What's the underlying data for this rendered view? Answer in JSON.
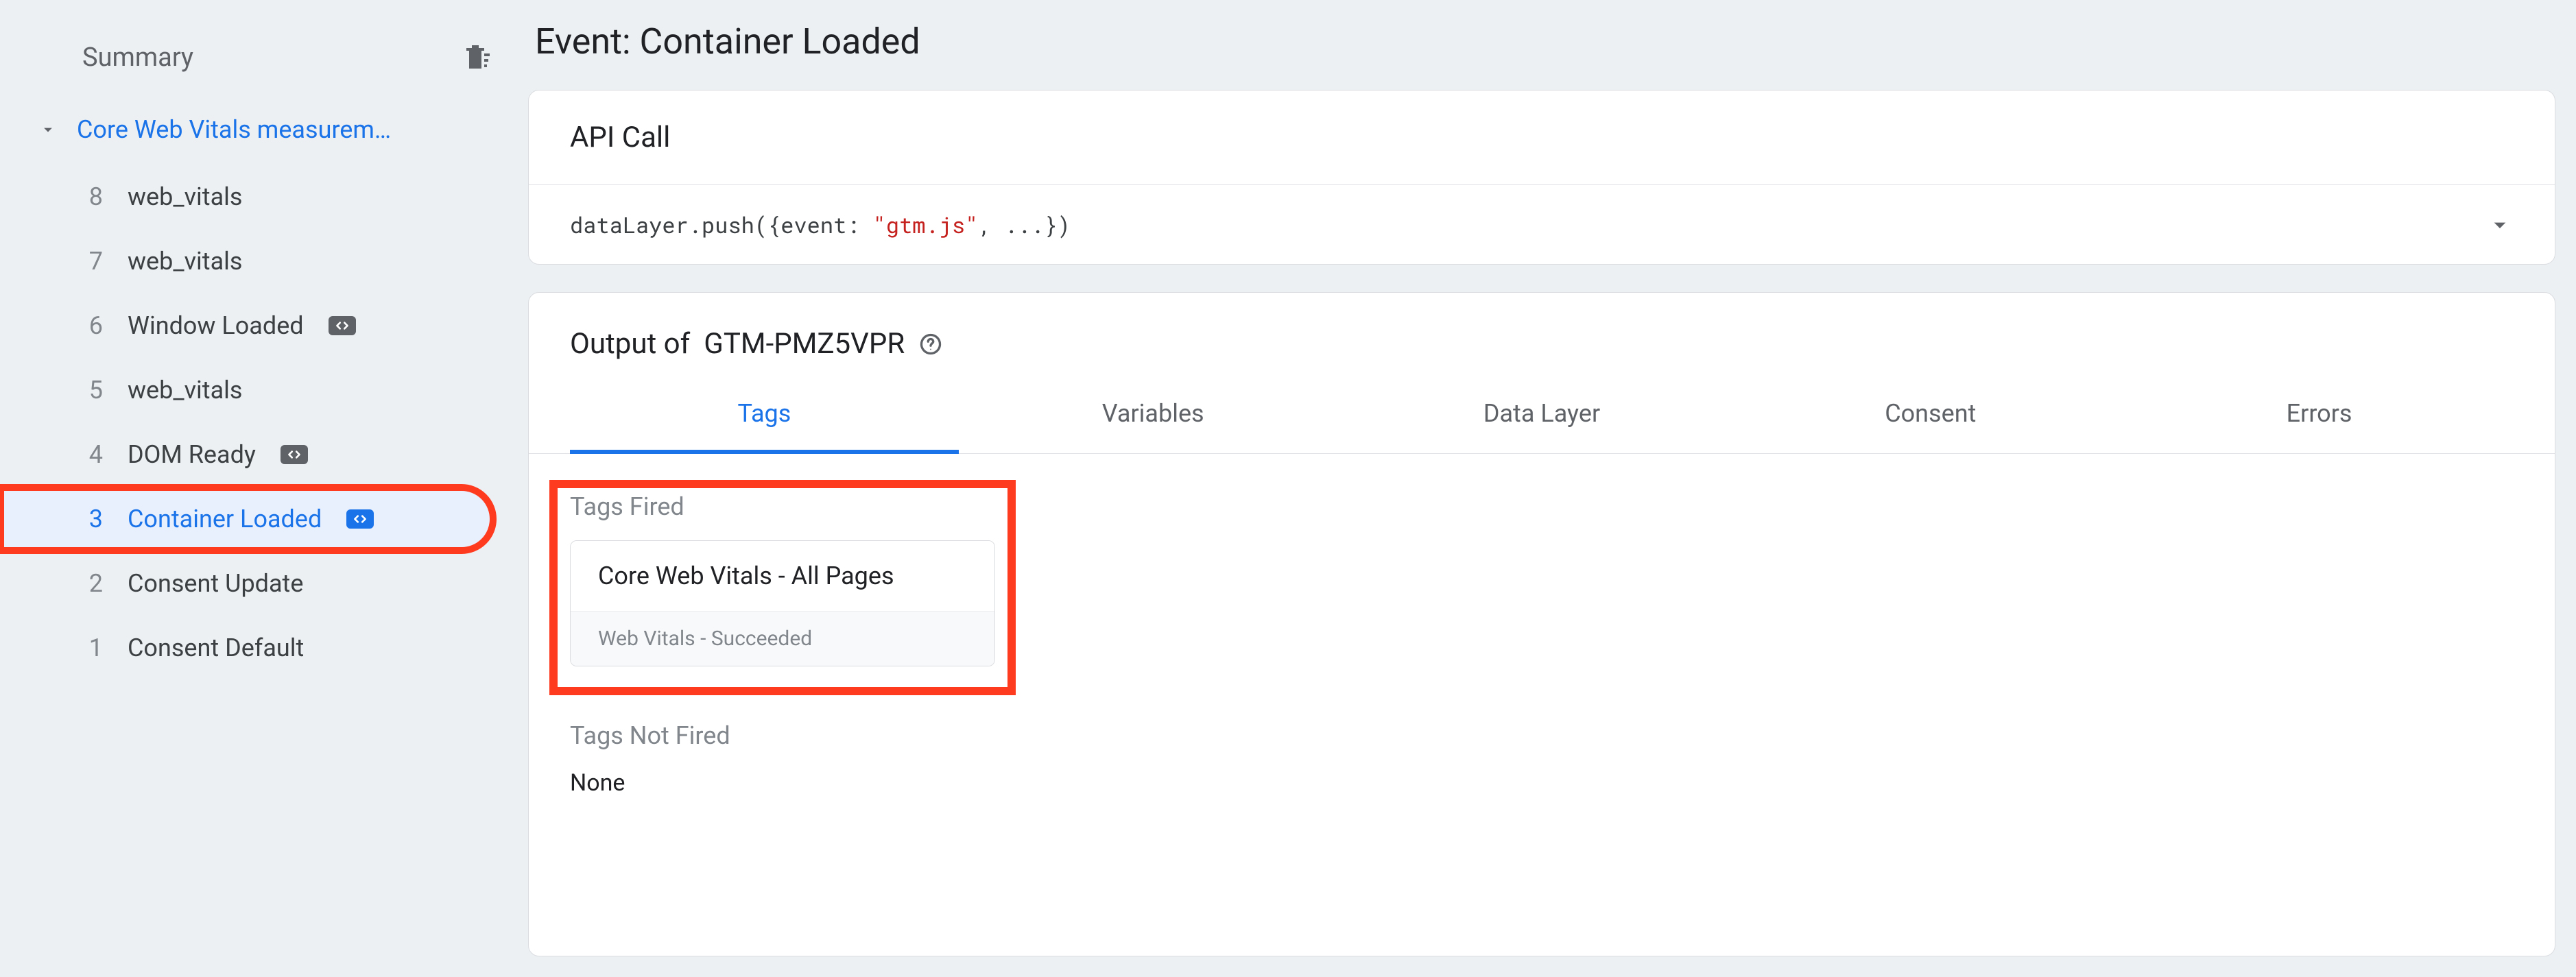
{
  "sidebar": {
    "title": "Summary",
    "group_label": "Core Web Vitals measurem…",
    "events": [
      {
        "index": "8",
        "name": "web_vitals",
        "badge": false,
        "active": false
      },
      {
        "index": "7",
        "name": "web_vitals",
        "badge": false,
        "active": false
      },
      {
        "index": "6",
        "name": "Window Loaded",
        "badge": true,
        "active": false
      },
      {
        "index": "5",
        "name": "web_vitals",
        "badge": false,
        "active": false
      },
      {
        "index": "4",
        "name": "DOM Ready",
        "badge": true,
        "active": false
      },
      {
        "index": "3",
        "name": "Container Loaded",
        "badge": true,
        "active": true
      },
      {
        "index": "2",
        "name": "Consent Update",
        "badge": false,
        "active": false
      },
      {
        "index": "1",
        "name": "Consent Default",
        "badge": false,
        "active": false
      }
    ]
  },
  "page": {
    "title_prefix": "Event: ",
    "title_event": "Container Loaded"
  },
  "api_call": {
    "heading": "API Call",
    "code_pre": "dataLayer.push({event: ",
    "code_str": "\"gtm.js\"",
    "code_post": ", ...})"
  },
  "output": {
    "heading_prefix": "Output of ",
    "container_id": "GTM-PMZ5VPR",
    "tabs": [
      "Tags",
      "Variables",
      "Data Layer",
      "Consent",
      "Errors"
    ],
    "active_tab": 0,
    "fired_label": "Tags Fired",
    "not_fired_label": "Tags Not Fired",
    "none_text": "None",
    "fired_tags": [
      {
        "title": "Core Web Vitals - All Pages",
        "subtitle": "Web Vitals - Succeeded"
      }
    ]
  }
}
